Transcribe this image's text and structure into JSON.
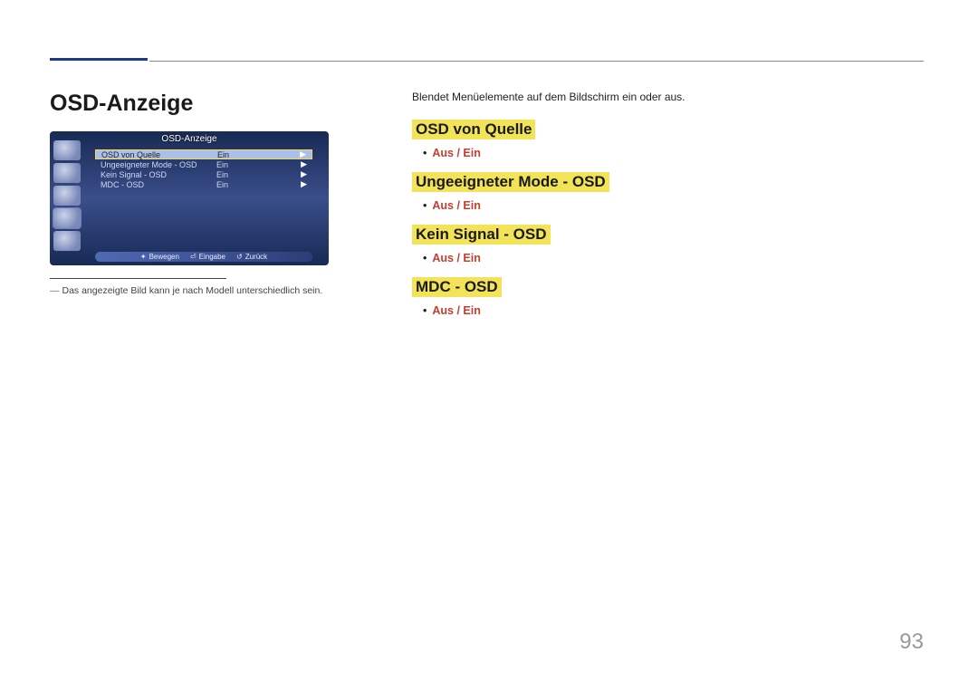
{
  "page": {
    "title": "OSD-Anzeige",
    "pageNumber": "93"
  },
  "osd": {
    "title": "OSD-Anzeige",
    "rows": [
      {
        "label": "OSD von Quelle",
        "value": "Ein"
      },
      {
        "label": "Ungeeigneter Mode - OSD",
        "value": "Ein"
      },
      {
        "label": "Kein Signal - OSD",
        "value": "Ein"
      },
      {
        "label": "MDC - OSD",
        "value": "Ein"
      }
    ],
    "footer": {
      "move": "Bewegen",
      "enter": "Eingabe",
      "back": "Zurück"
    }
  },
  "caption": {
    "text": "Das angezeigte Bild kann je nach Modell unterschiedlich sein."
  },
  "rightCol": {
    "intro": "Blendet Menüelemente auf dem Bildschirm ein oder aus.",
    "sections": [
      {
        "heading": "OSD von Quelle",
        "options": "Aus / Ein"
      },
      {
        "heading": "Ungeeigneter Mode - OSD",
        "options": "Aus / Ein"
      },
      {
        "heading": "Kein Signal - OSD",
        "options": "Aus / Ein"
      },
      {
        "heading": "MDC - OSD",
        "options": "Aus / Ein"
      }
    ]
  }
}
